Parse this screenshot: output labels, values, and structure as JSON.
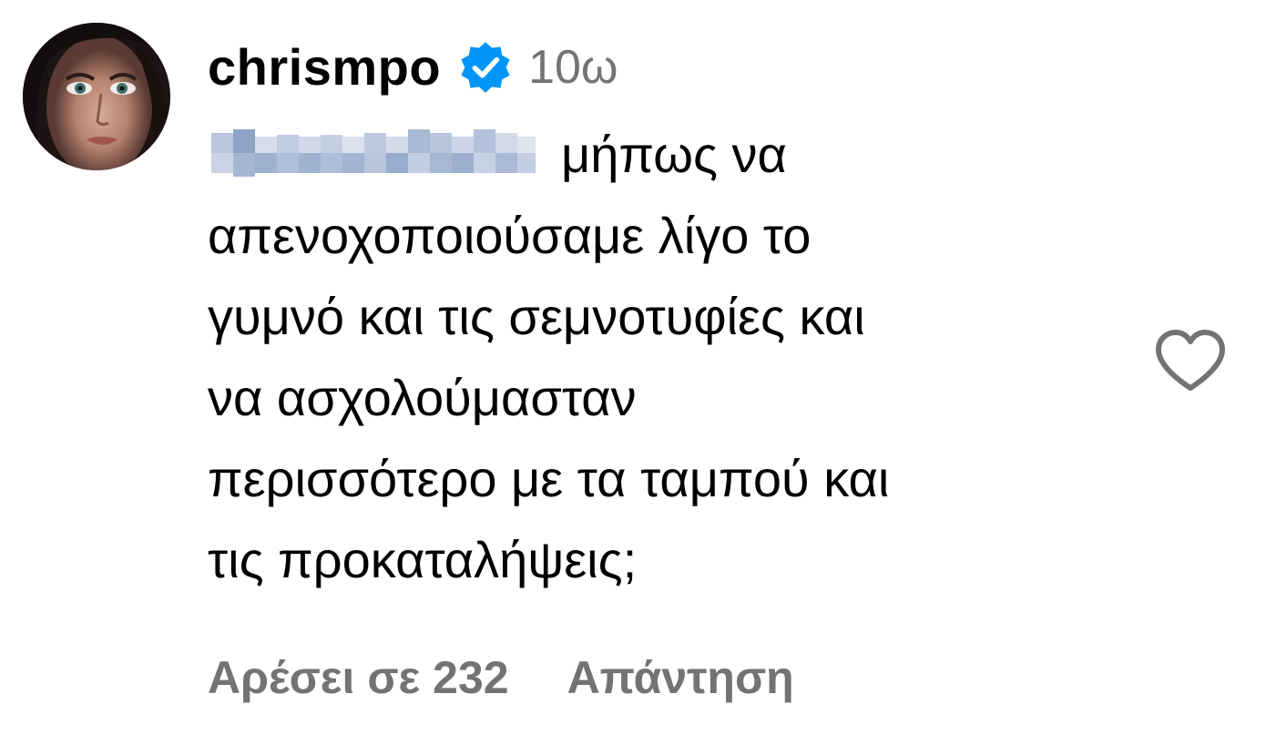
{
  "comment": {
    "author": {
      "username": "chrismpo",
      "verified": true,
      "avatar_icon": "profile-photo"
    },
    "time_ago": "10ω",
    "mention_blurred": true,
    "text_lines": [
      "μήπως να",
      "απενοχοποιούσαμε λίγο το",
      "γυμνό και τις σεμνοτυφίες και",
      "να ασχολούμασταν",
      "περισσότερο με τα ταμπού και",
      "τις προκαταλήψεις;"
    ],
    "likes_label": "Αρέσει σε 232",
    "reply_label": "Απάντηση",
    "like_icon": "heart-outline-icon",
    "colors": {
      "text": "#000000",
      "secondary": "#737373",
      "verified_badge": "#0095F6"
    }
  }
}
